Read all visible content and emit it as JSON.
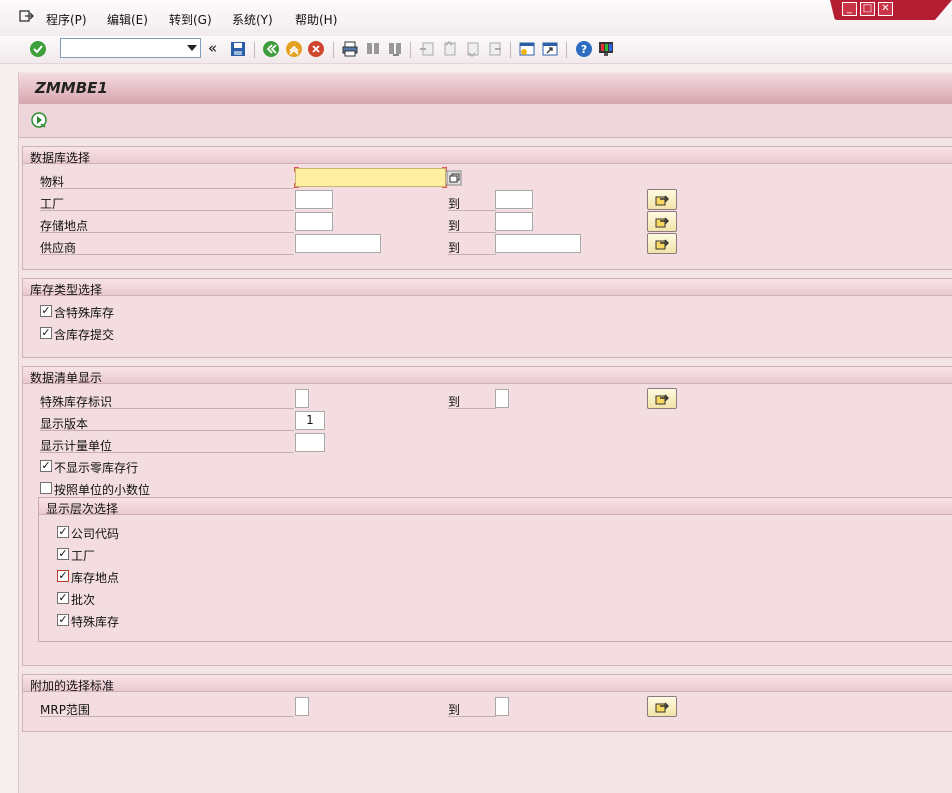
{
  "menu": {
    "items": [
      "程序(P)",
      "编辑(E)",
      "转到(G)",
      "系统(Y)",
      "帮助(H)"
    ]
  },
  "window": {
    "minimize": "_",
    "maximize": "□",
    "close": "✕"
  },
  "toolbar": {
    "command_value": "",
    "back_symbol": "«"
  },
  "page": {
    "title": "ZMMBE1"
  },
  "db_select": {
    "title": "数据库选择",
    "material_label": "物料",
    "plant_label": "工厂",
    "storage_label": "存储地点",
    "vendor_label": "供应商",
    "to_label": "到",
    "material_value": "",
    "plant_from": "",
    "plant_to": "",
    "storage_from": "",
    "storage_to": "",
    "vendor_from": "",
    "vendor_to": ""
  },
  "stock_type": {
    "title": "库存类型选择",
    "special_stock": {
      "label": "含特殊库存",
      "checked": true
    },
    "stock_commit": {
      "label": "含库存提交",
      "checked": true
    }
  },
  "list_display": {
    "title": "数据清单显示",
    "special_ind_label": "特殊库存标识",
    "to_label": "到",
    "version_label": "显示版本",
    "version_value": "1",
    "uom_label": "显示计量单位",
    "uom_value": "",
    "no_zero": {
      "label": "不显示零库存行",
      "checked": true
    },
    "by_unit_decimals": {
      "label": "按照单位的小数位",
      "checked": false
    },
    "hierarchy": {
      "title": "显示层次选择",
      "items": [
        {
          "label": "公司代码",
          "checked": true
        },
        {
          "label": "工厂",
          "checked": true
        },
        {
          "label": "库存地点",
          "checked": true
        },
        {
          "label": "批次",
          "checked": true
        },
        {
          "label": "特殊库存",
          "checked": true
        }
      ]
    }
  },
  "additional": {
    "title": "附加的选择标准",
    "mrp_label": "MRP范围",
    "to_label": "到"
  },
  "colors": {
    "accent": "#b51e32",
    "required_field": "#fdf0a0"
  }
}
